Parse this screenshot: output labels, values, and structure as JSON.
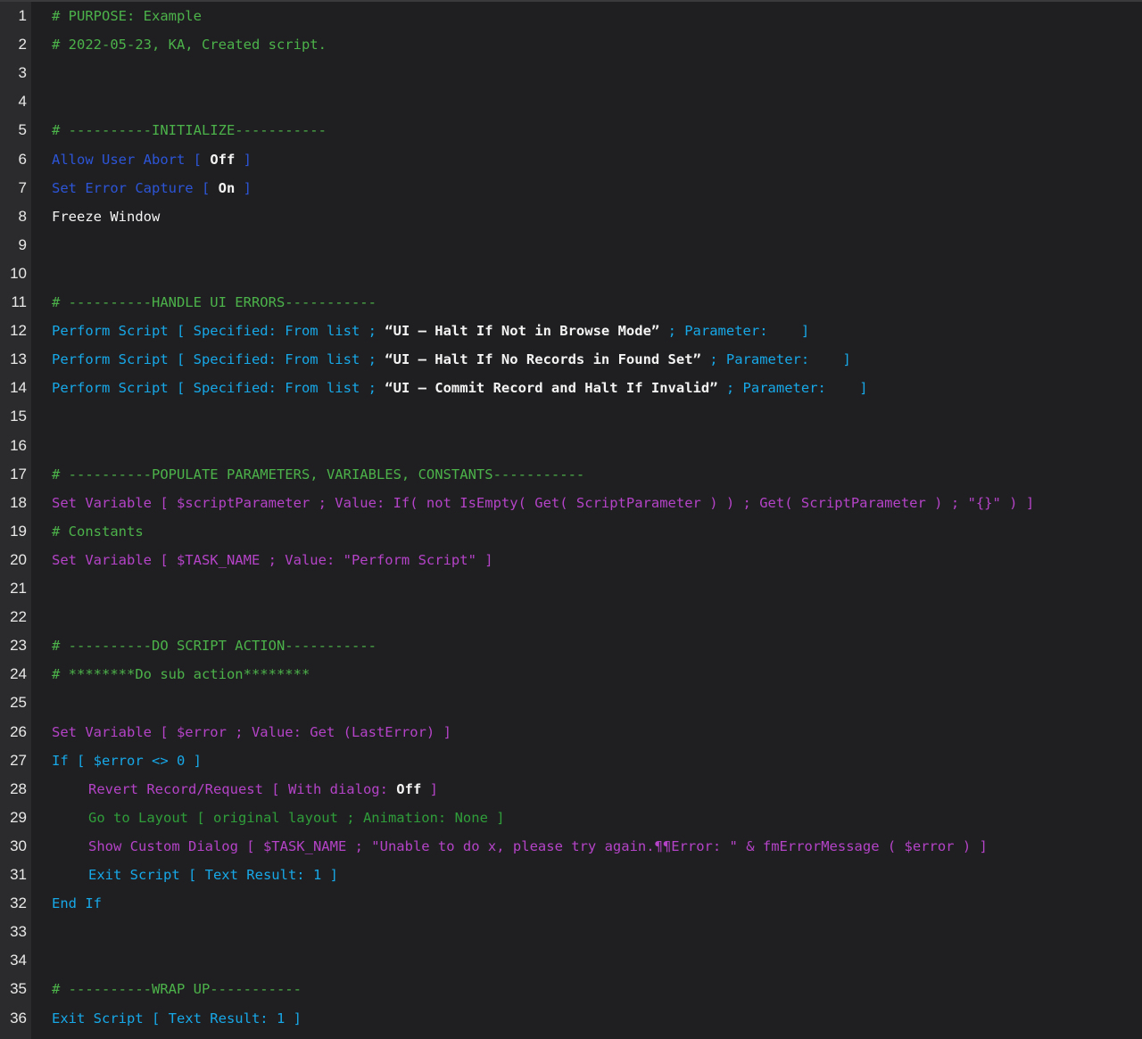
{
  "colors": {
    "background": "#1f1f21",
    "gutter": "#2b2b2d",
    "comment": "#4cb24a",
    "control_blue": "#2c55d8",
    "script_cyan": "#17a8e8",
    "variable_magenta": "#b443c7",
    "layout_green": "#2f9e3a",
    "text_white": "#f4f4f4"
  },
  "lines": [
    {
      "n": "1",
      "segments": [
        {
          "t": "# PURPOSE: Example",
          "c": "comment"
        }
      ]
    },
    {
      "n": "2",
      "segments": [
        {
          "t": "# 2022-05-23, KA, Created script.",
          "c": "comment"
        }
      ]
    },
    {
      "n": "3",
      "segments": []
    },
    {
      "n": "4",
      "segments": []
    },
    {
      "n": "5",
      "segments": [
        {
          "t": "# ----------INITIALIZE-----------",
          "c": "comment"
        }
      ]
    },
    {
      "n": "6",
      "segments": [
        {
          "t": "Allow User Abort [ ",
          "c": "blue"
        },
        {
          "t": "Off",
          "c": "whitebold"
        },
        {
          "t": " ]",
          "c": "blue"
        }
      ]
    },
    {
      "n": "7",
      "segments": [
        {
          "t": "Set Error Capture [ ",
          "c": "blue"
        },
        {
          "t": "On",
          "c": "whitebold"
        },
        {
          "t": " ]",
          "c": "blue"
        }
      ]
    },
    {
      "n": "8",
      "segments": [
        {
          "t": "Freeze Window",
          "c": "white"
        }
      ]
    },
    {
      "n": "9",
      "segments": []
    },
    {
      "n": "10",
      "segments": []
    },
    {
      "n": "11",
      "segments": [
        {
          "t": "# ----------HANDLE UI ERRORS-----------",
          "c": "comment"
        }
      ]
    },
    {
      "n": "12",
      "segments": [
        {
          "t": "Perform Script [ Specified: From list ; ",
          "c": "cyan"
        },
        {
          "t": "“UI – Halt If Not in Browse Mode”",
          "c": "whitebold"
        },
        {
          "t": " ; Parameter:    ]",
          "c": "cyan"
        }
      ]
    },
    {
      "n": "13",
      "segments": [
        {
          "t": "Perform Script [ Specified: From list ; ",
          "c": "cyan"
        },
        {
          "t": "“UI – Halt If No Records in Found Set”",
          "c": "whitebold"
        },
        {
          "t": " ; Parameter:    ]",
          "c": "cyan"
        }
      ]
    },
    {
      "n": "14",
      "segments": [
        {
          "t": "Perform Script [ Specified: From list ; ",
          "c": "cyan"
        },
        {
          "t": "“UI – Commit Record and Halt If Invalid”",
          "c": "whitebold"
        },
        {
          "t": " ; Parameter:    ]",
          "c": "cyan"
        }
      ]
    },
    {
      "n": "15",
      "segments": []
    },
    {
      "n": "16",
      "segments": []
    },
    {
      "n": "17",
      "segments": [
        {
          "t": "# ----------POPULATE PARAMETERS, VARIABLES, CONSTANTS-----------",
          "c": "comment"
        }
      ]
    },
    {
      "n": "18",
      "segments": [
        {
          "t": "Set Variable [ $scriptParameter ; Value: If( not IsEmpty( Get( ScriptParameter ) ) ; Get( ScriptParameter ) ; \"{}\" ) ]",
          "c": "magenta"
        }
      ]
    },
    {
      "n": "19",
      "segments": [
        {
          "t": "# Constants",
          "c": "comment"
        }
      ]
    },
    {
      "n": "20",
      "segments": [
        {
          "t": "Set Variable [ $TASK_NAME ; Value: \"Perform Script\" ]",
          "c": "magenta"
        }
      ]
    },
    {
      "n": "21",
      "segments": []
    },
    {
      "n": "22",
      "segments": []
    },
    {
      "n": "23",
      "segments": [
        {
          "t": "# ----------DO SCRIPT ACTION-----------",
          "c": "comment"
        }
      ]
    },
    {
      "n": "24",
      "segments": [
        {
          "t": "# ********Do sub action********",
          "c": "comment"
        }
      ]
    },
    {
      "n": "25",
      "segments": []
    },
    {
      "n": "26",
      "segments": [
        {
          "t": "Set Variable [ $error ; Value: Get (LastError) ]",
          "c": "magenta"
        }
      ]
    },
    {
      "n": "27",
      "segments": [
        {
          "t": "If [ $error <> 0 ]",
          "c": "cyan"
        }
      ]
    },
    {
      "n": "28",
      "indent": true,
      "segments": [
        {
          "t": "Revert Record/Request [ With dialog: ",
          "c": "magenta"
        },
        {
          "t": "Off",
          "c": "whitebold"
        },
        {
          "t": " ]",
          "c": "magenta"
        }
      ]
    },
    {
      "n": "29",
      "indent": true,
      "segments": [
        {
          "t": "Go to Layout [ original layout ; Animation: None ]",
          "c": "green"
        }
      ]
    },
    {
      "n": "30",
      "indent": true,
      "segments": [
        {
          "t": "Show Custom Dialog [ $TASK_NAME ; \"Unable to do x, please try again.¶¶Error: \" & fmErrorMessage ( $error ) ]",
          "c": "magenta"
        }
      ]
    },
    {
      "n": "31",
      "indent": true,
      "segments": [
        {
          "t": "Exit Script [ Text Result: 1 ]",
          "c": "cyan"
        }
      ]
    },
    {
      "n": "32",
      "segments": [
        {
          "t": "End If",
          "c": "cyan"
        }
      ]
    },
    {
      "n": "33",
      "segments": []
    },
    {
      "n": "34",
      "segments": []
    },
    {
      "n": "35",
      "segments": [
        {
          "t": "# ----------WRAP UP-----------",
          "c": "comment"
        }
      ]
    },
    {
      "n": "36",
      "segments": [
        {
          "t": "Exit Script [ Text Result: 1 ]",
          "c": "cyan"
        }
      ]
    }
  ]
}
